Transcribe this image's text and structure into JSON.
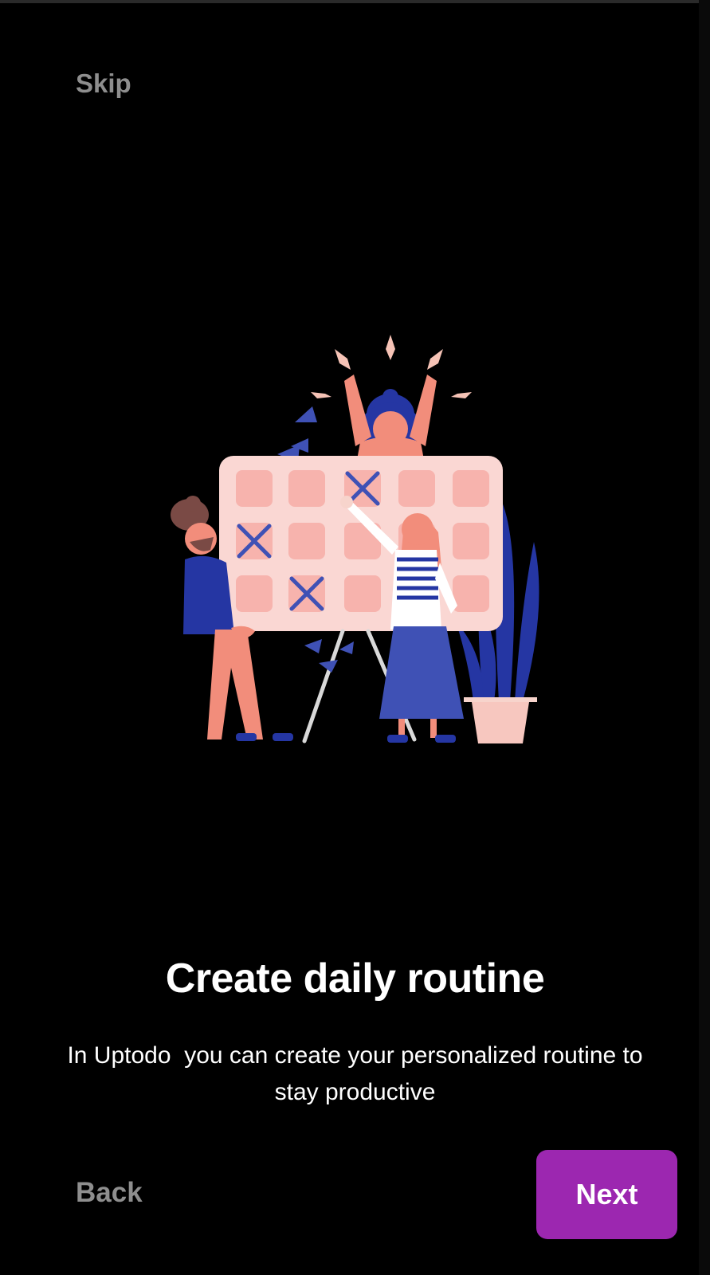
{
  "header": {
    "skip_label": "Skip"
  },
  "onboarding": {
    "illustration_icon": "planning-board-illustration",
    "title": "Create daily routine",
    "description": "In Uptodo  you can create your personalized routine to\nstay productive"
  },
  "footer": {
    "back_label": "Back",
    "next_label": "Next"
  },
  "colors": {
    "background": "#000000",
    "muted_text": "#8e8e8e",
    "primary": "#9c27b0",
    "text": "#ffffff"
  }
}
